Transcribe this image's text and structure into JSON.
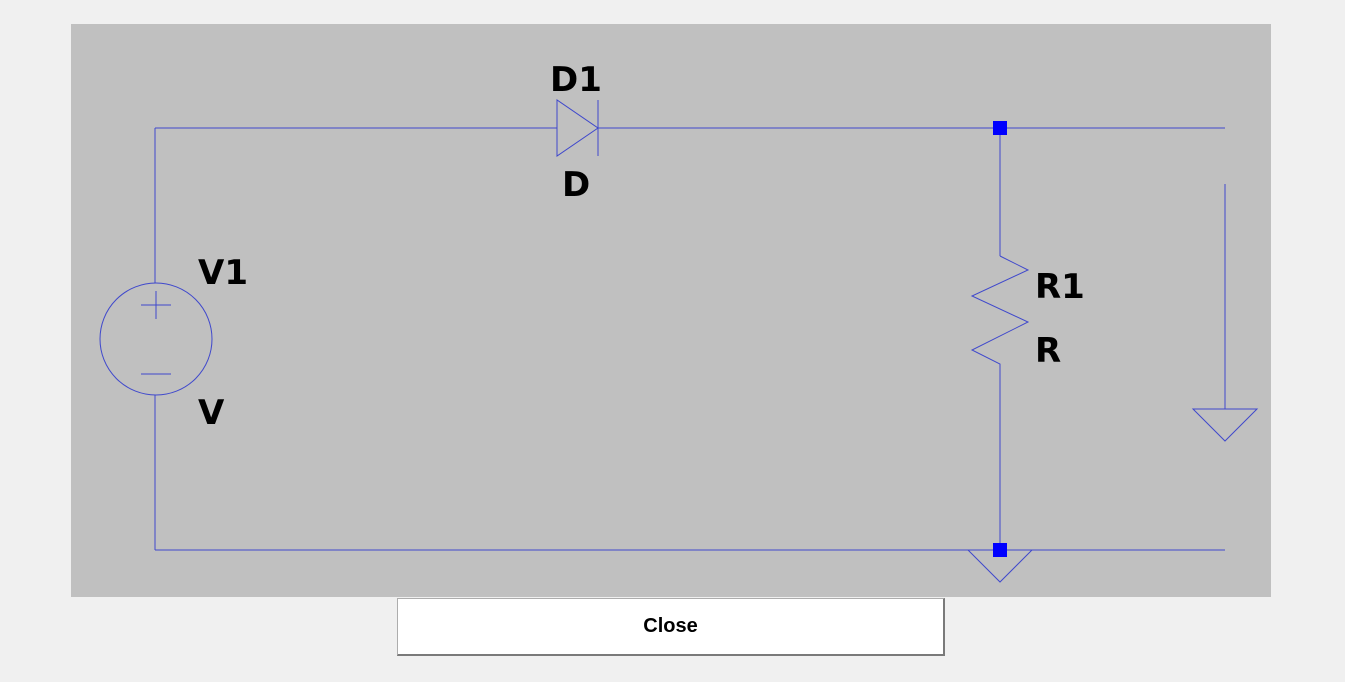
{
  "schematic": {
    "components": {
      "voltage_source": {
        "ref": "V1",
        "value": "V"
      },
      "diode": {
        "ref": "D1",
        "value": "D"
      },
      "resistor": {
        "ref": "R1",
        "value": "R"
      }
    },
    "colors": {
      "canvas_background": "#c0c0c0",
      "wire": "#3f48cc",
      "junction": "#0000ff",
      "label": "#000000"
    },
    "symbols": [
      "voltage-source",
      "diode",
      "resistor",
      "ground",
      "ground",
      "junction",
      "junction"
    ]
  },
  "dialog": {
    "close_label": "Close"
  }
}
